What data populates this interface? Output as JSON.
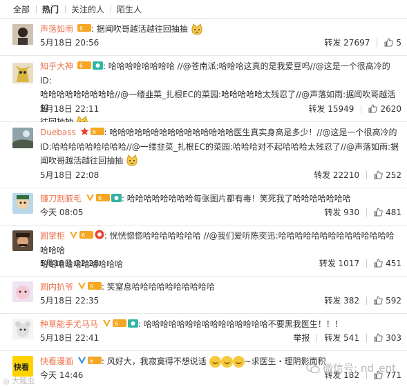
{
  "tabs": [
    "全部",
    "热门",
    "关注的人",
    "陌生人"
  ],
  "comments": [
    {
      "user": "声落如雨",
      "text_lines": [
        ": 据闻吹哥越活越往回抽抽"
      ],
      "date": "5月18日 20:56",
      "report": "",
      "repost": "转发 27697",
      "likes": "5"
    },
    {
      "user": "知乎大神",
      "text_lines": [
        ": 哈哈哈哈哈哈哈哈 //@苍南派:哈哈哈这真的是我爱豆吗//@这是一个很高冷的ID:",
        "哈哈哈哈哈哈哈哈哈//@一缕韭菜_扎根EC的菜园:哈哈哈哈哈太残忍了//@声落如雨:据闻吹哥越活越",
        "往回抽抽"
      ],
      "date": "5月18日 22:11",
      "report": "",
      "repost": "转发 15949",
      "likes": "2620"
    },
    {
      "user": "Duebass",
      "text_lines": [
        ": 哈哈哈哈哈哈哈哈哈哈哈哈哈哈哈医生真实身高是多少！//@这是一个很高冷的",
        "ID:哈哈哈哈哈哈哈哈哈//@一缕韭菜_扎根EC的菜园:哈哈哈对不起哈哈哈太残忍了//@声落如雨:据",
        "闻吹哥越活越往回抽抽"
      ],
      "date": "5月18日 22:08",
      "report": "",
      "repost": "转发 22210",
      "likes": "252"
    },
    {
      "user": "镰刀割腋毛",
      "text_lines": [
        ": 哈哈哈哈哈哈哈哈每张图片都有毒！笑死我了哈哈哈哈哈哈哈"
      ],
      "date": "今天 08:05",
      "report": "",
      "repost": "转发 930",
      "likes": "481"
    },
    {
      "user": "圆掌柜",
      "text_lines": [
        ": 恍恍惚惚哈哈哈哈哈哈哈 //@我们爱听陈奕迅:哈哈哈哈哈哈哈哈哈哈哈哈哈哈哈哈哈",
        "哈哈哈哈哈哈哈哈哈哈"
      ],
      "date": "5月18日 22:28",
      "report": "",
      "repost": "转发 1017",
      "likes": "451"
    },
    {
      "user": "圆内扒爷",
      "text_lines": [
        ": 笑窒息哈哈哈哈哈哈哈哈哈哈"
      ],
      "date": "5月18日 22:35",
      "report": "",
      "repost": "转发 382",
      "likes": "592"
    },
    {
      "user": "种草能手尤马马",
      "text_lines": [
        ": 哈哈哈哈哈哈哈哈哈哈哈哈哈哈哈不要黑我医生！！！"
      ],
      "date": "5月18日 22:41",
      "report": "举报",
      "repost": "转发 541",
      "likes": "303"
    },
    {
      "user": "快看漫画",
      "text_lines": [
        ": 风好大，我寂寞得不想说话",
        "~求医生・理阴影面积"
      ],
      "date": "今天 14:46",
      "report": "",
      "repost": "转发 182",
      "likes": "771"
    }
  ],
  "watermark": "微信号: nd_ent",
  "watermark2": "◎ 大瓢虫"
}
